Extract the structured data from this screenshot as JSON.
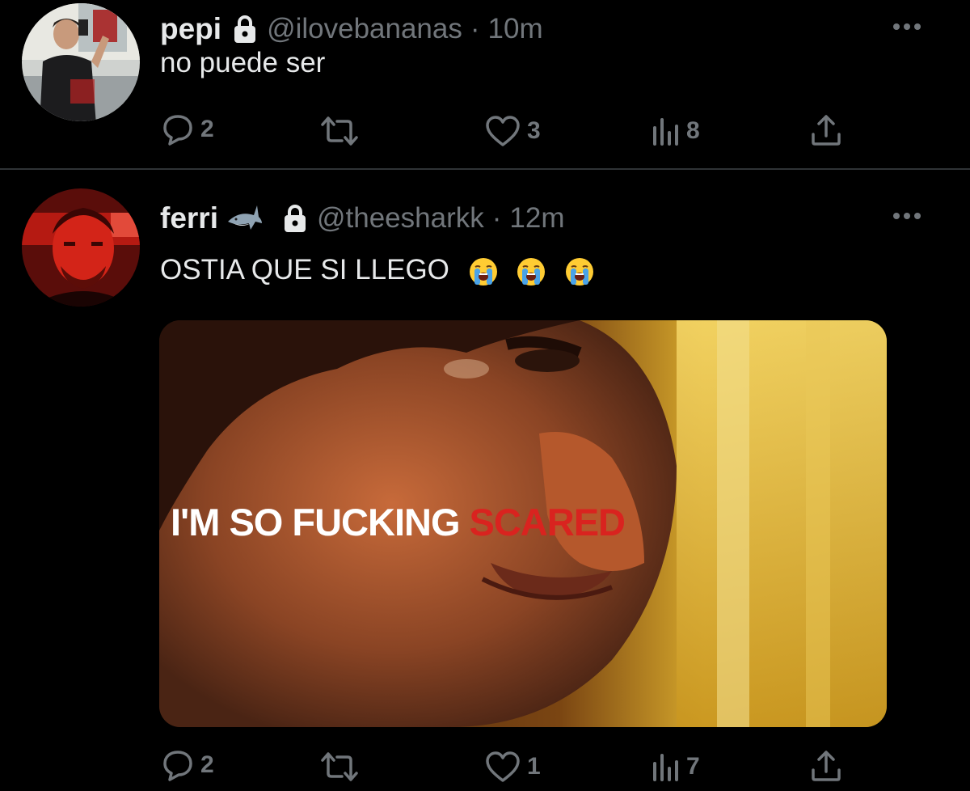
{
  "tweets": [
    {
      "display_name": "pepi",
      "handle": "@ilovebananas",
      "separator": "·",
      "time": "10m",
      "text": "no puede ser",
      "avatar_icon": "avatar-photo-man-mirror-selfie",
      "badges": [
        "lock-icon"
      ],
      "stats": {
        "replies": "2",
        "retweets": "",
        "likes": "3",
        "views": "8"
      }
    },
    {
      "display_name": "ferri",
      "handle": "@theesharkk",
      "separator": "·",
      "time": "12m",
      "text": "OSTIA QUE SI LLEGO",
      "emojis": [
        "loudly-crying-face",
        "loudly-crying-face",
        "loudly-crying-face"
      ],
      "avatar_icon": "avatar-photo-man-red-light",
      "badges": [
        "shark-emoji",
        "lock-icon"
      ],
      "media": {
        "caption_white": "I'M SO FUCKING",
        "caption_red": "SCARED"
      },
      "stats": {
        "replies": "2",
        "retweets": "",
        "likes": "1",
        "views": "7"
      }
    }
  ],
  "icons": {
    "reply": "speech-bubble-icon",
    "retweet": "retweet-arrows-icon",
    "like": "heart-icon",
    "views": "bar-chart-icon",
    "share": "share-upload-icon",
    "more": "three-dots-icon"
  },
  "colors": {
    "background": "#000000",
    "primary_text": "#e7e9ea",
    "secondary_text": "#71767b",
    "divider": "#2f3336",
    "caption_red": "#d9231f"
  }
}
